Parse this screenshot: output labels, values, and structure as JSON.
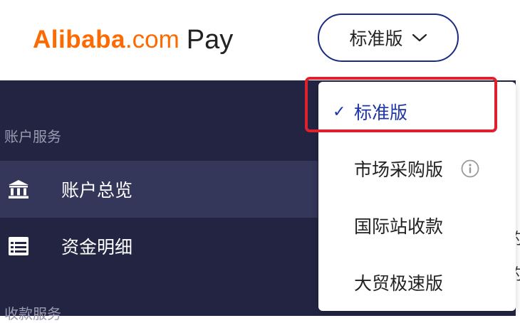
{
  "header": {
    "logo": {
      "brand": "Alibaba",
      "domain": ".com",
      "product": "Pay"
    },
    "edition_select": {
      "value": "标准版",
      "icon": "chevron-down-icon"
    }
  },
  "sidebar": {
    "sections": [
      {
        "title": "账户服务",
        "items": [
          {
            "label": "账户总览",
            "icon": "bank-icon",
            "active": true
          },
          {
            "label": "资金明细",
            "icon": "table-icon",
            "active": false
          }
        ]
      },
      {
        "title": "收款服务",
        "items": []
      }
    ],
    "partial_right_text": [
      "的",
      "的"
    ]
  },
  "dropdown": {
    "options": [
      {
        "label": "标准版",
        "selected": true,
        "check": "✓"
      },
      {
        "label": "市场采购版",
        "selected": false,
        "has_info_icon": true
      },
      {
        "label": "国际站收款",
        "selected": false
      },
      {
        "label": "大贸极速版",
        "selected": false
      }
    ]
  },
  "colors": {
    "brand_orange": "#ff6a00",
    "sidebar_bg": "#232442",
    "sidebar_active_bg": "#34365a",
    "accent_blue": "#1c34a5",
    "highlight_red": "#e0202c"
  }
}
